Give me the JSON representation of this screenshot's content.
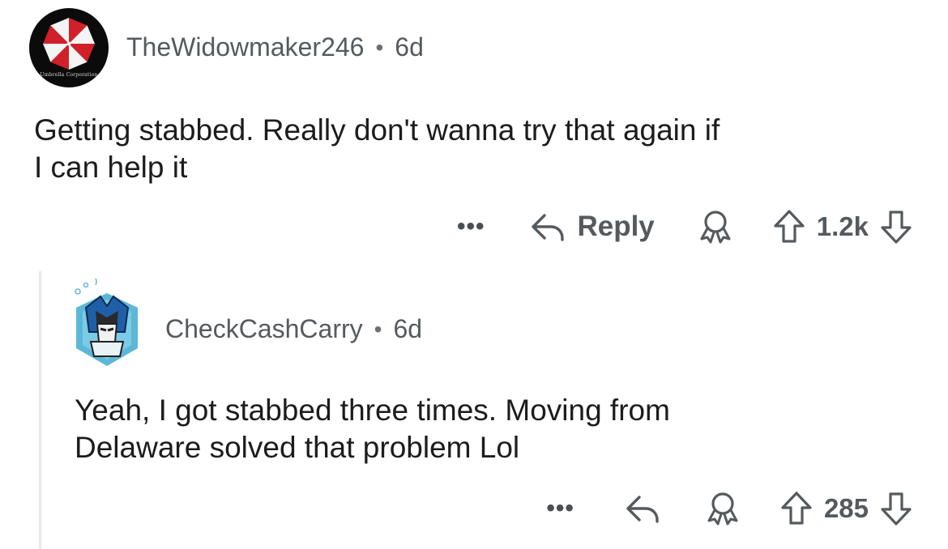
{
  "top_comment": {
    "avatar": {
      "icon": "umbrella-logo-icon",
      "logo_caption": "Umbrella Corporation"
    },
    "username": "TheWidowmaker246",
    "separator": "•",
    "age": "6d",
    "body_line1": "Getting stabbed. Really don't wanna try that again if",
    "body_line2": "I can help it",
    "actions": {
      "more_label": "•••",
      "reply_label": "Reply",
      "score": "1.2k"
    }
  },
  "reply_comment": {
    "avatar": {
      "icon": "robot-avatar-icon"
    },
    "username": "CheckCashCarry",
    "separator": "•",
    "age": "6d",
    "body_line1": "Yeah, I got stabbed three times. Moving from",
    "body_line2": "Delaware solved that problem Lol",
    "actions": {
      "more_label": "•••",
      "score": "285"
    }
  },
  "colors": {
    "text": "#1c1c1c",
    "meta": "#555a5e",
    "umbrella_red": "#d0202a",
    "thread_line": "#e6e8ea"
  }
}
